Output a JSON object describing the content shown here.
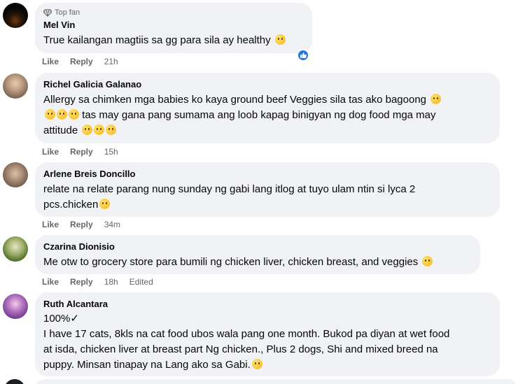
{
  "comments": [
    {
      "badge": "Top fan",
      "name": "Mel Vin",
      "lines": [
        "True kailangan magtiis sa gg para sila ay healthy"
      ],
      "like": "Like",
      "reply": "Reply",
      "time": "21h",
      "edited": ""
    },
    {
      "name": "Richel Galicia Galanao",
      "lines": [
        "Allergy sa chimken mga babies ko kaya ground beef Veggies sila tas ako bagoong",
        "tas may gana pang sumama ang loob kapag binigyan ng dog food mga may",
        "attitude"
      ],
      "like": "Like",
      "reply": "Reply",
      "time": "15h",
      "edited": ""
    },
    {
      "name": "Arlene Breis Doncillo",
      "lines": [
        "relate na relate parang nung sunday ng gabi lang itlog at tuyo ulam ntin si lyca 2",
        "pcs.chicken"
      ],
      "like": "Like",
      "reply": "Reply",
      "time": "34m",
      "edited": ""
    },
    {
      "name": "Czarina Dionisio",
      "lines": [
        "Me otw to grocery store para bumili ng chicken liver, chicken breast, and veggies"
      ],
      "like": "Like",
      "reply": "Reply",
      "time": "18h",
      "edited": "Edited"
    },
    {
      "name": "Ruth Alcantara",
      "lines": [
        "100%✓",
        "I have 17 cats, 8kls na cat food ubos wala pang one month. Bukod pa diyan at wet food",
        "at isda, chicken liver at breast part Ng chicken., Plus 2 dogs, Shi and mixed breed na",
        "puppy. Minsan tinapay na Lang ako sa Gabi."
      ]
    }
  ],
  "colors": {
    "bubble": "#f0f2f5",
    "meta": "#65676b",
    "like_blue": "#1877f2"
  },
  "icons": [
    "diamond-icon",
    "like-reaction-icon",
    "emoji-icon"
  ]
}
